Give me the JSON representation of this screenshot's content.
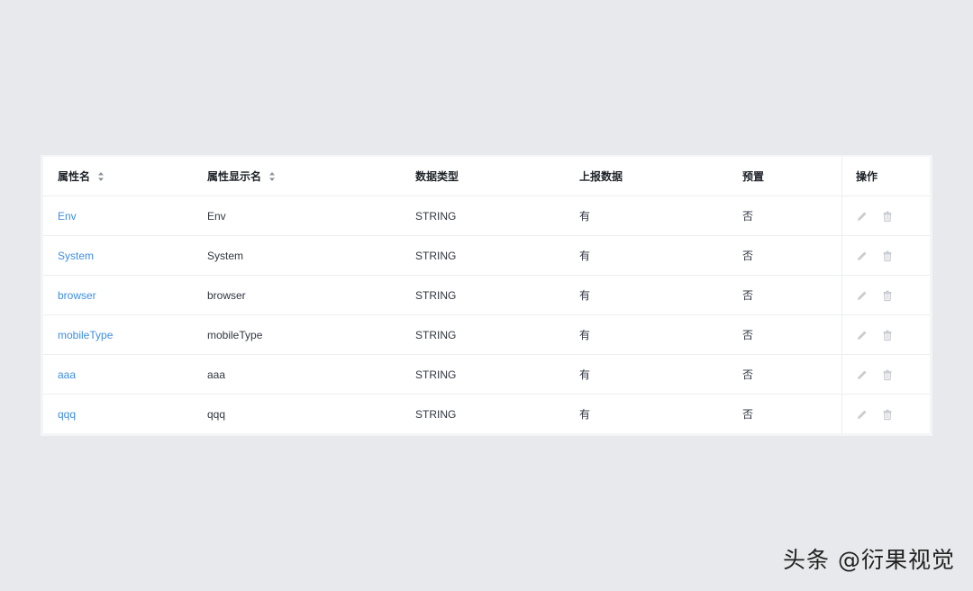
{
  "table": {
    "headers": {
      "name": "属性名",
      "display_name": "属性显示名",
      "data_type": "数据类型",
      "report": "上报数据",
      "preset": "预置",
      "actions": "操作"
    },
    "rows": [
      {
        "name": "Env",
        "display_name": "Env",
        "data_type": "STRING",
        "report": "有",
        "preset": "否"
      },
      {
        "name": "System",
        "display_name": "System",
        "data_type": "STRING",
        "report": "有",
        "preset": "否"
      },
      {
        "name": "browser",
        "display_name": "browser",
        "data_type": "STRING",
        "report": "有",
        "preset": "否"
      },
      {
        "name": "mobileType",
        "display_name": "mobileType",
        "data_type": "STRING",
        "report": "有",
        "preset": "否"
      },
      {
        "name": "aaa",
        "display_name": "aaa",
        "data_type": "STRING",
        "report": "有",
        "preset": "否"
      },
      {
        "name": "qqq",
        "display_name": "qqq",
        "data_type": "STRING",
        "report": "有",
        "preset": "否"
      }
    ],
    "action_icons": [
      "edit-icon",
      "delete-icon"
    ]
  },
  "watermark": "头条 @衍果视觉",
  "colors": {
    "background": "#e8e9ec",
    "link": "#3c8ee4",
    "text": "#303540",
    "icon_disabled": "#c9ccd1"
  }
}
